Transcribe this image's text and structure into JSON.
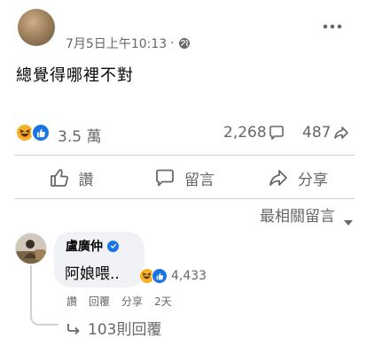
{
  "post": {
    "timestamp": "7月5日上午10:13",
    "separator": "·",
    "text": "總覺得哪裡不對"
  },
  "stats": {
    "reaction_count": "3.5 萬",
    "comment_count": "2,268",
    "share_count": "487"
  },
  "actions": {
    "like_label": "讚",
    "comment_label": "留言",
    "share_label": "分享"
  },
  "sort": {
    "label": "最相關留言"
  },
  "comment": {
    "author": "盧廣仲",
    "text": "阿娘喂..",
    "reaction_count": "4,433",
    "like_label": "讚",
    "reply_label": "回覆",
    "share_label": "分享",
    "time": "2天"
  },
  "replies": {
    "label": "103則回覆"
  },
  "colors": {
    "like_blue": "#1b74e4",
    "haha_yellow": "#f7b125",
    "secondary_text": "#65676b",
    "bubble_bg": "#f0f2f5"
  },
  "icons": [
    "globe-icon",
    "more-icon",
    "haha-icon",
    "like-icon",
    "comment-icon",
    "share-icon",
    "thumb-up-icon",
    "caret-down-icon",
    "verified-icon",
    "reply-arrow-icon"
  ]
}
